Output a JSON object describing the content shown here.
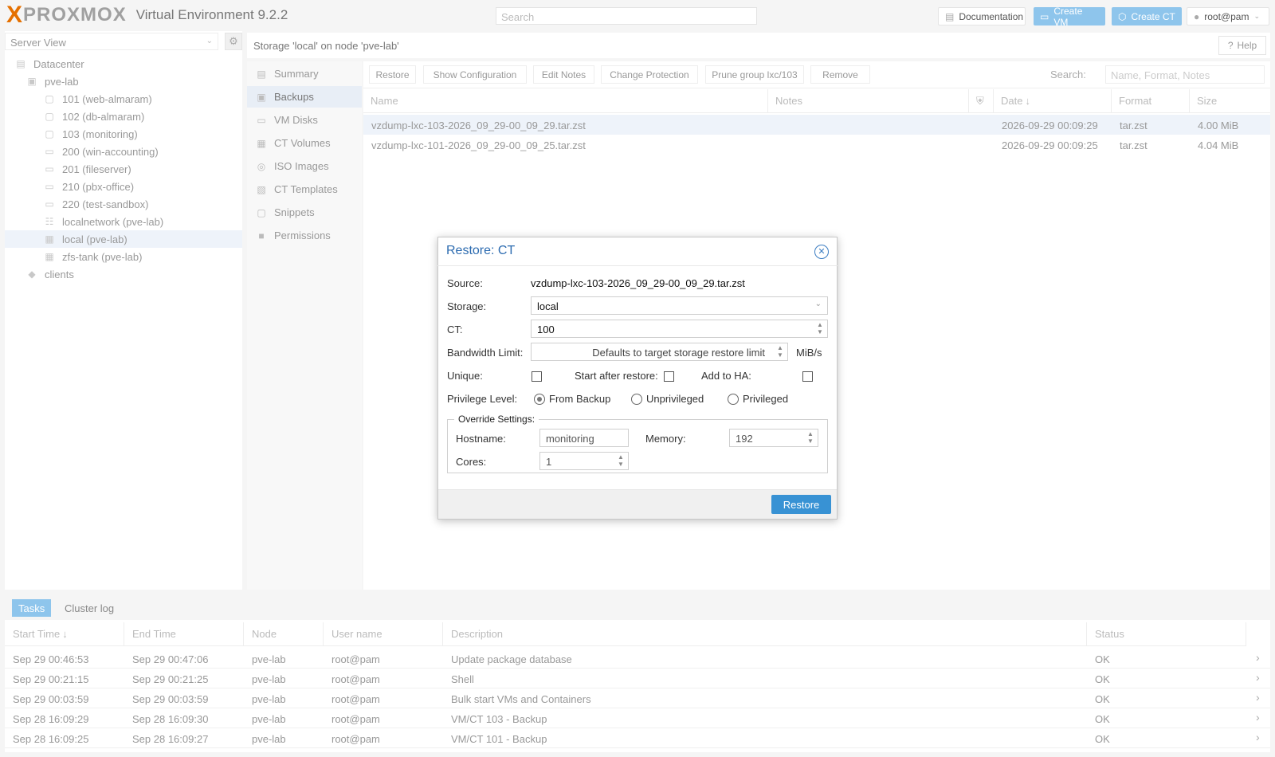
{
  "header": {
    "logo_x": "X",
    "logo_word": "PROXMOX",
    "product": "Virtual Environment 9.2.2",
    "search_placeholder": "Search",
    "documentation": "Documentation",
    "create_vm": "Create VM",
    "create_ct": "Create CT",
    "user": "root@pam"
  },
  "tree": {
    "view": "Server View",
    "items": [
      {
        "label": "Datacenter",
        "icon": "datacenter-icon"
      },
      {
        "label": "pve-lab",
        "icon": "node-icon"
      },
      {
        "label": "101 (web-almaram)",
        "icon": "container-icon"
      },
      {
        "label": "102 (db-almaram)",
        "icon": "container-icon"
      },
      {
        "label": "103 (monitoring)",
        "icon": "container-icon"
      },
      {
        "label": "200 (win-accounting)",
        "icon": "vm-icon"
      },
      {
        "label": "201 (fileserver)",
        "icon": "vm-icon"
      },
      {
        "label": "210 (pbx-office)",
        "icon": "vm-icon"
      },
      {
        "label": "220 (test-sandbox)",
        "icon": "vm-icon"
      },
      {
        "label": "localnetwork (pve-lab)",
        "icon": "network-icon"
      },
      {
        "label": "local (pve-lab)",
        "icon": "storage-icon"
      },
      {
        "label": "zfs-tank (pve-lab)",
        "icon": "storage-icon"
      },
      {
        "label": "clients",
        "icon": "tag-icon"
      }
    ]
  },
  "content": {
    "title": "Storage 'local' on node 'pve-lab'",
    "help": "Help"
  },
  "subnav": [
    "Summary",
    "Backups",
    "VM Disks",
    "CT Volumes",
    "ISO Images",
    "CT Templates",
    "Snippets",
    "Permissions"
  ],
  "toolbar": {
    "restore": "Restore",
    "show_config": "Show Configuration",
    "edit_notes": "Edit Notes",
    "change_protection": "Change Protection",
    "prune": "Prune group lxc/103",
    "remove": "Remove",
    "search_label": "Search:",
    "search_placeholder": "Name, Format, Notes"
  },
  "grid": {
    "columns": [
      "Name",
      "Notes",
      "",
      "Date",
      "Format",
      "Size"
    ],
    "rows": [
      {
        "name": "vzdump-lxc-103-2026_09_29-00_09_29.tar.zst",
        "notes": "",
        "date": "2026-09-29 00:09:29",
        "format": "tar.zst",
        "size": "4.00 MiB"
      },
      {
        "name": "vzdump-lxc-101-2026_09_29-00_09_25.tar.zst",
        "notes": "",
        "date": "2026-09-29 00:09:25",
        "format": "tar.zst",
        "size": "4.04 MiB"
      }
    ]
  },
  "dialog": {
    "title": "Restore: CT",
    "source_label": "Source:",
    "source": "vzdump-lxc-103-2026_09_29-00_09_29.tar.zst",
    "storage_label": "Storage:",
    "storage": "local",
    "ct_label": "CT:",
    "ct": "100",
    "bw_label": "Bandwidth Limit:",
    "bw_placeholder": "Defaults to target storage restore limit",
    "bw_unit": "MiB/s",
    "unique_label": "Unique:",
    "start_label": "Start after restore:",
    "ha_label": "Add to HA:",
    "priv_label": "Privilege Level:",
    "priv_options": [
      "From Backup",
      "Unprivileged",
      "Privileged"
    ],
    "override_legend": "Override Settings:",
    "hostname_label": "Hostname:",
    "hostname": "monitoring",
    "memory_label": "Memory:",
    "memory": "192",
    "cores_label": "Cores:",
    "cores": "1",
    "restore_button": "Restore"
  },
  "tasks": {
    "tabs": [
      "Tasks",
      "Cluster log"
    ],
    "columns": [
      "Start Time",
      "End Time",
      "Node",
      "User name",
      "Description",
      "Status"
    ],
    "rows": [
      {
        "start": "Sep 29 00:46:53",
        "end": "Sep 29 00:47:06",
        "node": "pve-lab",
        "user": "root@pam",
        "desc": "Update package database",
        "status": "OK"
      },
      {
        "start": "Sep 29 00:21:15",
        "end": "Sep 29 00:21:25",
        "node": "pve-lab",
        "user": "root@pam",
        "desc": "Shell",
        "status": "OK"
      },
      {
        "start": "Sep 29 00:03:59",
        "end": "Sep 29 00:03:59",
        "node": "pve-lab",
        "user": "root@pam",
        "desc": "Bulk start VMs and Containers",
        "status": "OK"
      },
      {
        "start": "Sep 28 16:09:29",
        "end": "Sep 28 16:09:30",
        "node": "pve-lab",
        "user": "root@pam",
        "desc": "VM/CT 103 - Backup",
        "status": "OK"
      },
      {
        "start": "Sep 28 16:09:25",
        "end": "Sep 28 16:09:27",
        "node": "pve-lab",
        "user": "root@pam",
        "desc": "VM/CT 101 - Backup",
        "status": "OK"
      }
    ]
  }
}
